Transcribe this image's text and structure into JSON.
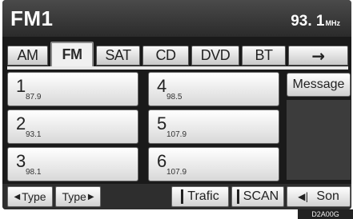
{
  "header": {
    "source": "FM1",
    "frequency": "93. 1",
    "unit": "MHz"
  },
  "tabs": [
    {
      "label": "AM",
      "active": false
    },
    {
      "label": "FM",
      "active": true
    },
    {
      "label": "SAT",
      "active": false
    },
    {
      "label": "CD",
      "active": false
    },
    {
      "label": "DVD",
      "active": false
    },
    {
      "label": "BT",
      "active": false
    },
    {
      "label": "→",
      "icon": "right-arrow-icon",
      "active": false
    }
  ],
  "presets": [
    {
      "number": "1",
      "frequency": "87.9"
    },
    {
      "number": "2",
      "frequency": "93.1"
    },
    {
      "number": "3",
      "frequency": "98.1"
    },
    {
      "number": "4",
      "frequency": "98.5"
    },
    {
      "number": "5",
      "frequency": "107.9"
    },
    {
      "number": "6",
      "frequency": "107.9"
    }
  ],
  "message_label": "Message",
  "bottom": {
    "type_prev_label": "Type",
    "type_next_label": "Type",
    "trafic_label": "Trafic",
    "scan_label": "SCAN",
    "sound_label": "Son"
  },
  "stamp": "D2A00G"
}
